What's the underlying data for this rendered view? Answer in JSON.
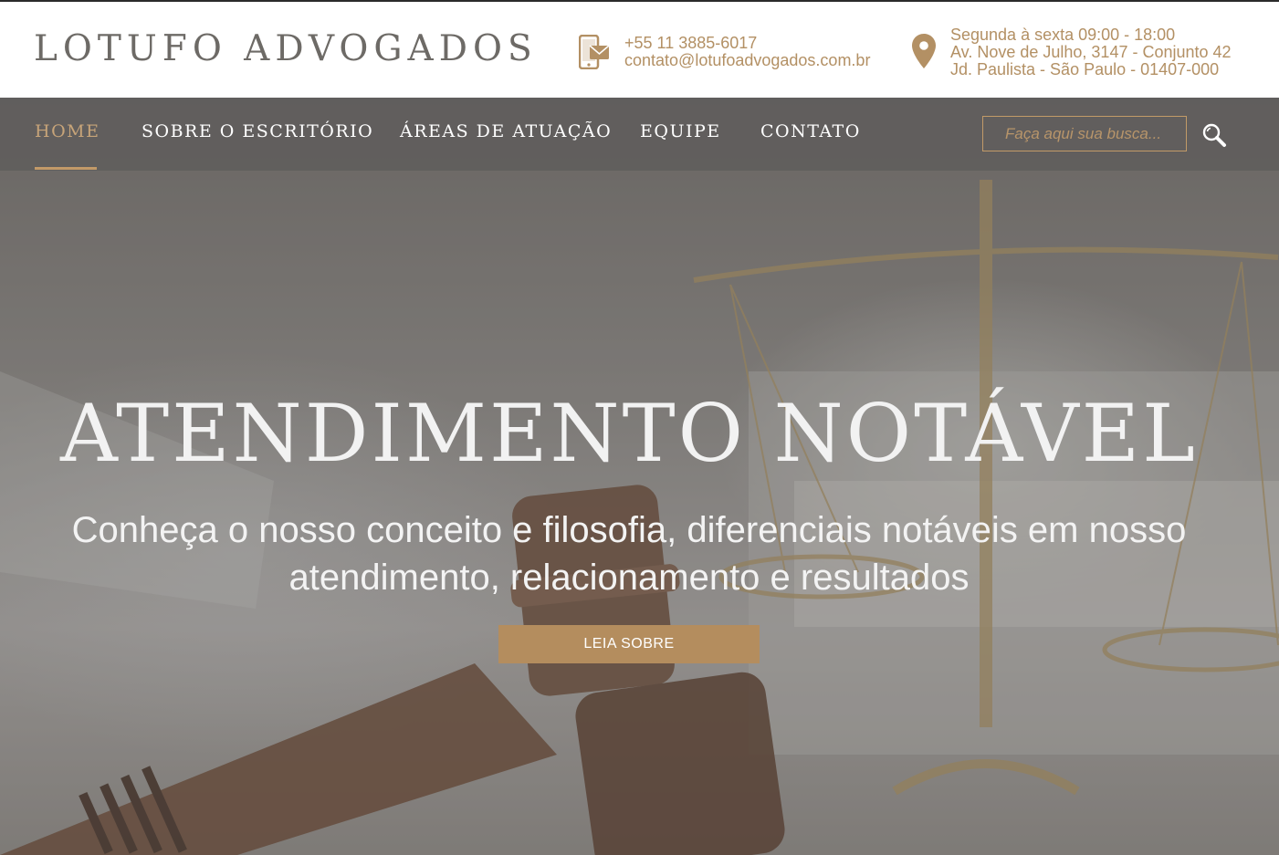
{
  "colors": {
    "accent": "#b48d5e",
    "logo": "#6d6a66",
    "nav_bg": "#5f5d5c",
    "white": "#ffffff"
  },
  "header": {
    "logo": "LOTUFO ADVOGADOS",
    "contact": {
      "icon": "phone-mail-icon",
      "phone": "+55 11 3885-6017",
      "email": "contato@lotufoadvogados.com.br"
    },
    "address": {
      "icon": "map-pin-icon",
      "hours": "Segunda à sexta 09:00 - 18:00",
      "line1": "Av. Nove de Julho, 3147 - Conjunto 42",
      "line2": "Jd. Paulista - São Paulo - 01407-000"
    }
  },
  "nav": {
    "items": [
      {
        "label": "HOME",
        "active": true
      },
      {
        "label": "SOBRE O ESCRITÓRIO",
        "active": false
      },
      {
        "label": "ÁREAS DE ATUAÇÃO",
        "active": false
      },
      {
        "label": "EQUIPE",
        "active": false
      },
      {
        "label": "CONTATO",
        "active": false
      }
    ],
    "search": {
      "placeholder": "Faça aqui sua busca...",
      "value": "",
      "icon": "search-icon"
    }
  },
  "hero": {
    "title": "ATENDIMENTO NOTÁVEL",
    "subtitle": "Conheça o nosso conceito e filosofia, diferenciais notáveis em nosso atendimento, relacionamento e resultados",
    "cta": "LEIA SOBRE"
  }
}
